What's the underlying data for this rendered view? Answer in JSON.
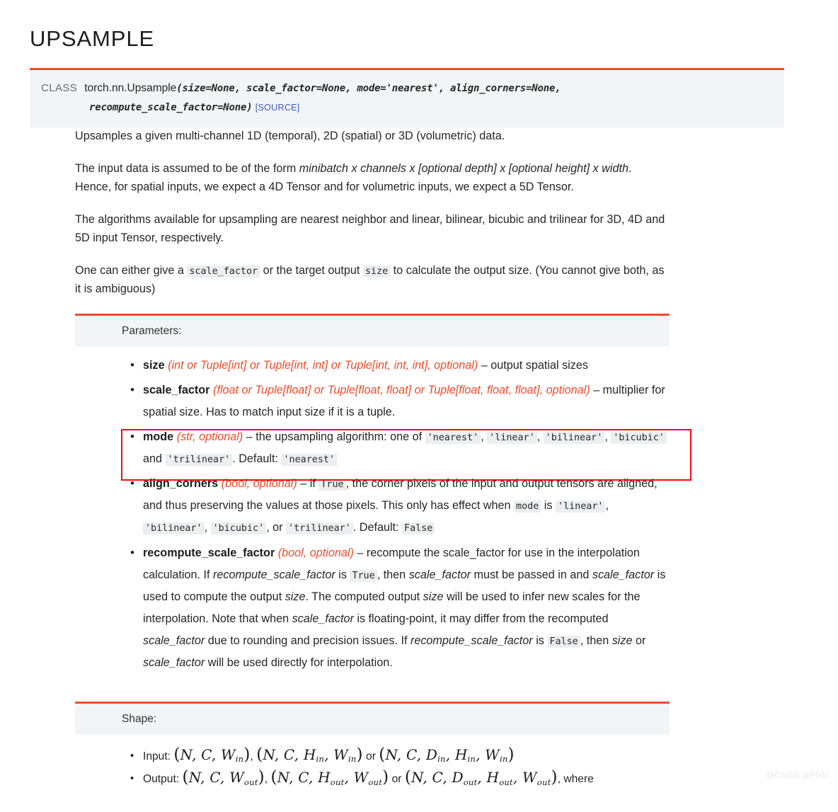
{
  "page": {
    "title": "UPSAMPLE",
    "watermark": "@CSDN @Philo"
  },
  "signature": {
    "kind_label": "CLASS",
    "qualified_name": "torch.nn.Upsample",
    "open_paren": "(",
    "params_line1": "size=None, scale_factor=None, mode='nearest', align_corners=None,",
    "params_line2": "recompute_scale_factor=None",
    "close_paren": ")",
    "source_link": "[SOURCE]"
  },
  "description": {
    "p1": "Upsamples a given multi-channel 1D (temporal), 2D (spatial) or 3D (volumetric) data.",
    "p2_a": "The input data is assumed to be of the form ",
    "p2_em": "minibatch x channels x [optional depth] x [optional height] x width",
    "p2_b": ". Hence, for spatial inputs, we expect a 4D Tensor and for volumetric inputs, we expect a 5D Tensor.",
    "p3": "The algorithms available for upsampling are nearest neighbor and linear, bilinear, bicubic and trilinear for 3D, 4D and 5D input Tensor, respectively.",
    "p4_a": "One can either give a ",
    "p4_code1": "scale_factor",
    "p4_b": " or the target output ",
    "p4_code2": "size",
    "p4_c": " to calculate the output size. (You cannot give both, as it is ambiguous)"
  },
  "parameters": {
    "heading": "Parameters:",
    "items": [
      {
        "name": "size",
        "type_open": "(",
        "type_text": "int or Tuple[int] or Tuple[int, int] or Tuple[int, int, int], optional",
        "type_close": ")",
        "desc": " – output spatial sizes"
      },
      {
        "name": "scale_factor",
        "type_text": "float or Tuple[float] or Tuple[float, float] or Tuple[float, float, float], optional",
        "desc": " – multiplier for spatial size. Has to match input size if it is a tuple."
      },
      {
        "name": "mode",
        "type_text": "str, optional",
        "desc_a": " – the upsampling algorithm: one of ",
        "code_nearest": "'nearest'",
        "code_linear": "'linear'",
        "code_bilinear": "'bilinear'",
        "code_bicubic": "'bicubic'",
        "desc_and": " and ",
        "code_trilinear": "'trilinear'",
        "desc_b": ". Default: ",
        "code_default": "'nearest'",
        "highlighted": true
      },
      {
        "name": "align_corners",
        "type_text": "bool, optional",
        "desc_a": " – if ",
        "code_true": "True",
        "desc_b": ", the corner pixels of the input and output tensors are aligned, and thus preserving the values at those pixels. This only has effect when ",
        "code_mode": "mode",
        "desc_c": " is ",
        "code_linear": "'linear'",
        "code_bilinear": "'bilinear'",
        "code_bicubic": "'bicubic'",
        "desc_or": ", or ",
        "code_trilinear": "'trilinear'",
        "desc_d": ". Default: ",
        "code_false": "False"
      },
      {
        "name": "recompute_scale_factor",
        "type_text": "bool, optional",
        "desc_a": " – recompute the scale_factor for use in the interpolation calculation. If ",
        "em_rsf": "recompute_scale_factor",
        "desc_b": " is ",
        "code_true": "True",
        "desc_c": ", then ",
        "em_sf1": "scale_factor",
        "desc_d": " must be passed in and ",
        "em_sf2": "scale_factor",
        "desc_e": " is used to compute the output ",
        "em_size1": "size",
        "desc_f": ". The computed output ",
        "em_size2": "size",
        "desc_g": " will be used to infer new scales for the interpolation. Note that when ",
        "em_sf3": "scale_factor",
        "desc_h": " is floating-point, it may differ from the recomputed ",
        "em_sf4": "scale_factor",
        "desc_i": " due to rounding and precision issues. If ",
        "em_rsf2": "recompute_scale_factor",
        "desc_j": " is ",
        "code_false": "False",
        "desc_k": ", then ",
        "em_size3": "size",
        "desc_l": " or ",
        "em_sf5": "scale_factor",
        "desc_m": " will be used directly for interpolation."
      }
    ]
  },
  "shape": {
    "heading": "Shape:",
    "input_label": "Input:",
    "input_math_1": "(N, C, W_in)",
    "input_math_2": "(N, C, H_in, W_in)",
    "input_or": "or",
    "input_math_3": "(N, C, D_in, H_in, W_in)",
    "output_label": "Output:",
    "output_math_1": "(N, C, W_out)",
    "output_math_2": "(N, C, H_out, W_out)",
    "output_or": "or",
    "output_math_3": "(N, C, D_out, H_out, W_out)",
    "output_suffix": ", where"
  },
  "colors": {
    "accent": "#ee4c2c",
    "annotation": "#fb0b0b",
    "link": "#3d5bbd",
    "code_bg": "#eceef2",
    "panel_bg": "#f3f4f7"
  }
}
